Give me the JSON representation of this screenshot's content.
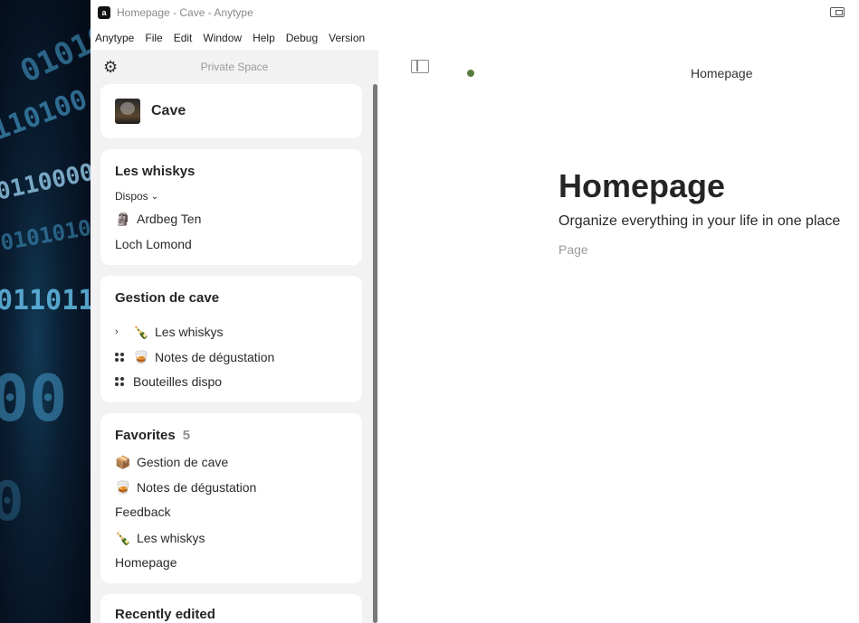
{
  "window": {
    "title": "Homepage - Cave - Anytype"
  },
  "menubar": [
    "Anytype",
    "File",
    "Edit",
    "Window",
    "Help",
    "Debug",
    "Version"
  ],
  "sidebar": {
    "space_name": "Private Space",
    "space_card": {
      "name": "Cave"
    },
    "whiskys": {
      "title": "Les whiskys",
      "view": "Dispos",
      "items": [
        {
          "label": "Ardbeg Ten",
          "icon": "whisky-figure-icon"
        },
        {
          "label": "Loch Lomond",
          "icon": ""
        }
      ]
    },
    "gestion": {
      "title": "Gestion de cave",
      "items": [
        {
          "label": "Les whiskys",
          "icon": "bottles-icon"
        },
        {
          "label": "Notes de dégustation",
          "icon": "glass-icon"
        },
        {
          "label": "Bouteilles dispo",
          "icon": ""
        }
      ]
    },
    "favorites": {
      "title": "Favorites",
      "count": "5",
      "items": [
        {
          "label": "Gestion de cave",
          "icon": "crate-icon"
        },
        {
          "label": "Notes de dégustation",
          "icon": "glass-icon"
        },
        {
          "label": "Feedback",
          "icon": ""
        },
        {
          "label": "Les whiskys",
          "icon": "bottles-icon"
        },
        {
          "label": "Homepage",
          "icon": ""
        }
      ]
    },
    "recent": {
      "title": "Recently edited"
    }
  },
  "main": {
    "header_title": "Homepage",
    "title": "Homepage",
    "description": "Organize everything in your life in one place",
    "type": "Page"
  },
  "colors": {
    "sync_status": "#5a7d3f",
    "sidebar_bg": "#f2f2f2"
  }
}
